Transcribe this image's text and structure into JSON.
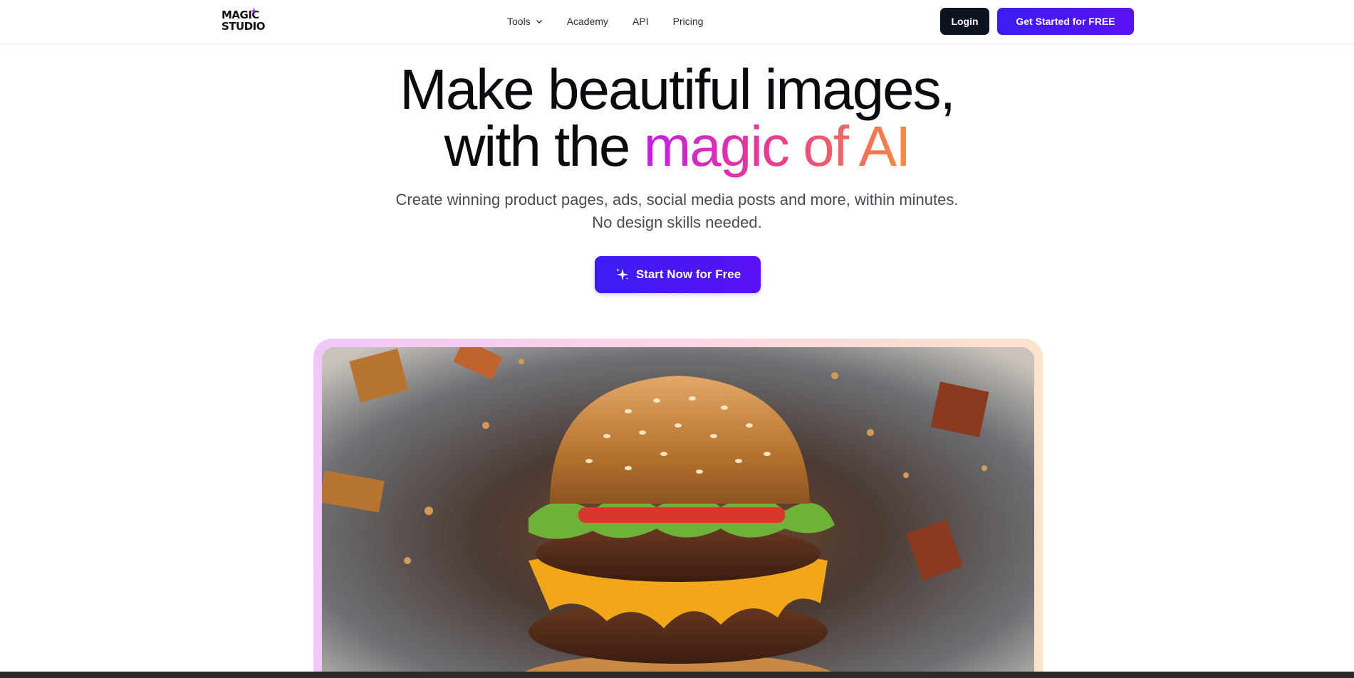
{
  "brand": {
    "logo_line1": "MAGIC",
    "logo_line2": "STUDIO"
  },
  "nav": {
    "tools": "Tools",
    "academy": "Academy",
    "api": "API",
    "pricing": "Pricing"
  },
  "header": {
    "login": "Login",
    "get_started": "Get Started for FREE"
  },
  "hero": {
    "title_line1": "Make beautiful images,",
    "title_line2_plain": "with the ",
    "title_line2_gradient": "magic of AI",
    "subtitle_line1": "Create winning product pages, ads, social media posts and more, within minutes.",
    "subtitle_line2": "No design skills needed.",
    "cta": "Start Now for Free"
  },
  "colors": {
    "primary": "#3b1cf2",
    "dark": "#0e1322",
    "gradient_start": "#c21ee6",
    "gradient_end": "#f78c3b"
  },
  "icons": [
    "sparkle-icon",
    "chevron-down-icon",
    "burger-image"
  ]
}
